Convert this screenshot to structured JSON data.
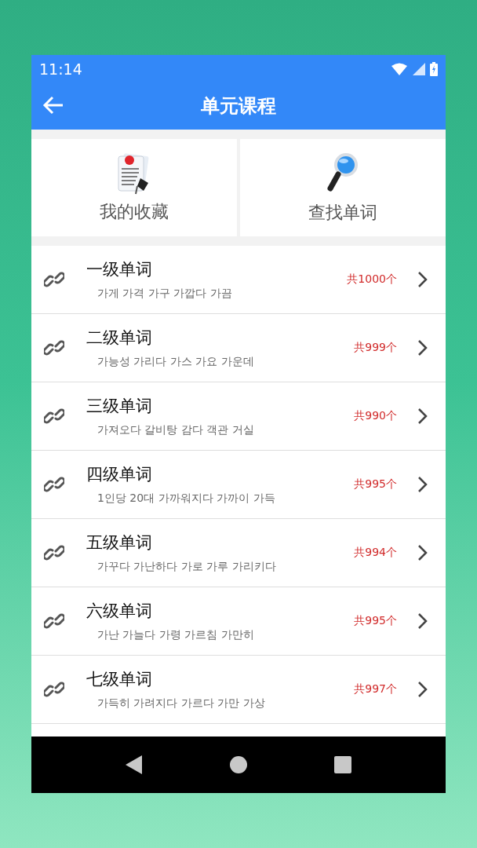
{
  "status_bar": {
    "time": "11:14"
  },
  "app_bar": {
    "title": "单元课程"
  },
  "shortcuts": [
    {
      "kind": "favorites",
      "label": "我的收藏"
    },
    {
      "kind": "search",
      "label": "查找单词"
    }
  ],
  "levels": [
    {
      "title": "一级单词",
      "preview": "가게 가격 가구 가깝다 가끔",
      "count": "共1000个"
    },
    {
      "title": "二级单词",
      "preview": "가능성 가리다 가스 가요 가운데",
      "count": "共999个"
    },
    {
      "title": "三级单词",
      "preview": "가져오다 갈비탕 감다 객관 거실",
      "count": "共990个"
    },
    {
      "title": "四级单词",
      "preview": "1인당 20대 가까워지다 가까이 가득",
      "count": "共995个"
    },
    {
      "title": "五级单词",
      "preview": "가꾸다 가난하다 가로 가루 가리키다",
      "count": "共994个"
    },
    {
      "title": "六级单词",
      "preview": "가난 가늘다 가령 가르침 가만히",
      "count": "共995个"
    },
    {
      "title": "七级单词",
      "preview": "가득히 가려지다 가르다 가만 가상",
      "count": "共997个"
    }
  ]
}
